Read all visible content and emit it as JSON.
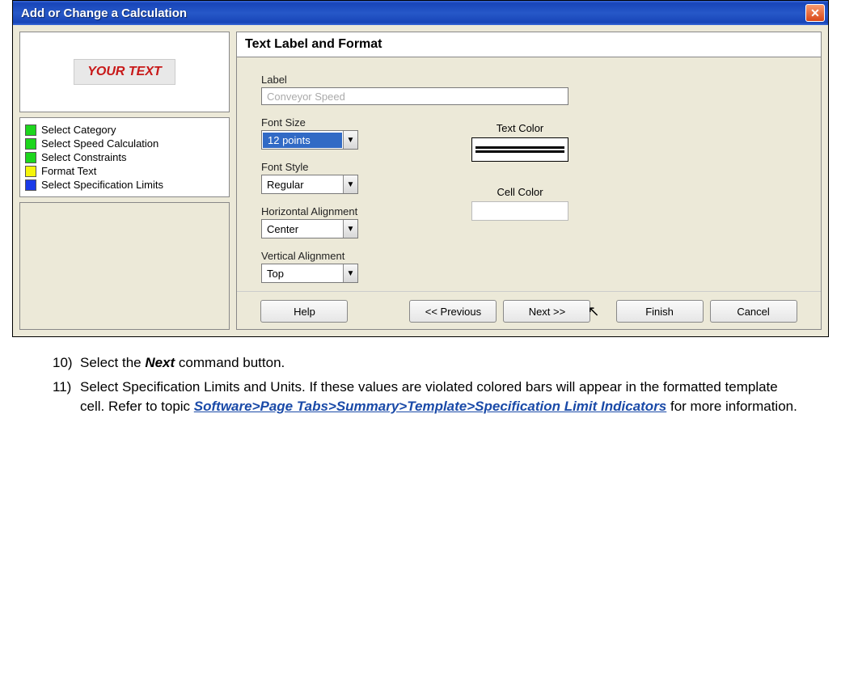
{
  "titlebar": {
    "title": "Add or Change a Calculation"
  },
  "preview": {
    "text": "YOUR TEXT"
  },
  "steps": [
    {
      "color": "#1dd61d",
      "label": "Select Category"
    },
    {
      "color": "#1dd61d",
      "label": "Select Speed Calculation"
    },
    {
      "color": "#1dd61d",
      "label": "Select Constraints"
    },
    {
      "color": "#f5f50a",
      "label": "Format Text"
    },
    {
      "color": "#1a3ae8",
      "label": "Select Specification Limits"
    }
  ],
  "panel": {
    "title": "Text Label and Format",
    "label_label": "Label",
    "label_value": "Conveyor Speed",
    "fontsize_label": "Font Size",
    "fontsize_value": "12 points",
    "fontstyle_label": "Font Style",
    "fontstyle_value": "Regular",
    "halign_label": "Horizontal Alignment",
    "halign_value": "Center",
    "valign_label": "Vertical Alignment",
    "valign_value": "Top",
    "textcolor_label": "Text Color",
    "cellcolor_label": "Cell Color"
  },
  "buttons": {
    "help": "Help",
    "previous": "<< Previous",
    "next": "Next >>",
    "finish": "Finish",
    "cancel": "Cancel"
  },
  "instructions": {
    "item10_num": "10)",
    "item10_a": "Select the ",
    "item10_b": "Next",
    "item10_c": " command button.",
    "item11_num": "11)",
    "item11_a": "Select Specification Limits and Units. If these values are violated colored bars will appear in the formatted template cell. Refer to   topic ",
    "item11_link": "Software>Page Tabs>Summary>Template>Specification Limit Indicators",
    "item11_b": " for more information."
  }
}
